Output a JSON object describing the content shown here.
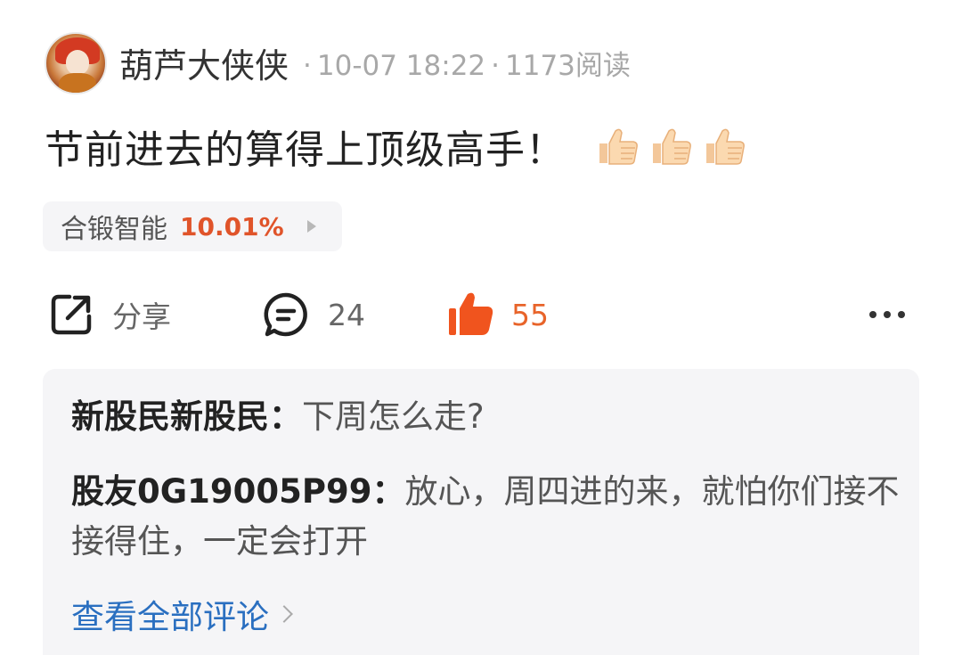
{
  "post": {
    "author": "葫芦大侠侠",
    "time": "10-07 18:22",
    "reads": "1173阅读",
    "content": "节前进去的算得上顶级高手！",
    "emoji_count": 3
  },
  "stock": {
    "name": "合锻智能",
    "change": "10.01%",
    "change_color": "#e0542a"
  },
  "actions": {
    "share_label": "分享",
    "comment_count": "24",
    "like_count": "55",
    "like_color": "#e8642a"
  },
  "comments": [
    {
      "author": "新股民新股民：",
      "text": "下周怎么走?"
    },
    {
      "author": "股友0G19005P99：",
      "text": "放心，周四进的来，就怕你们接不接得住，一定会打开"
    }
  ],
  "view_all": "查看全部评论"
}
